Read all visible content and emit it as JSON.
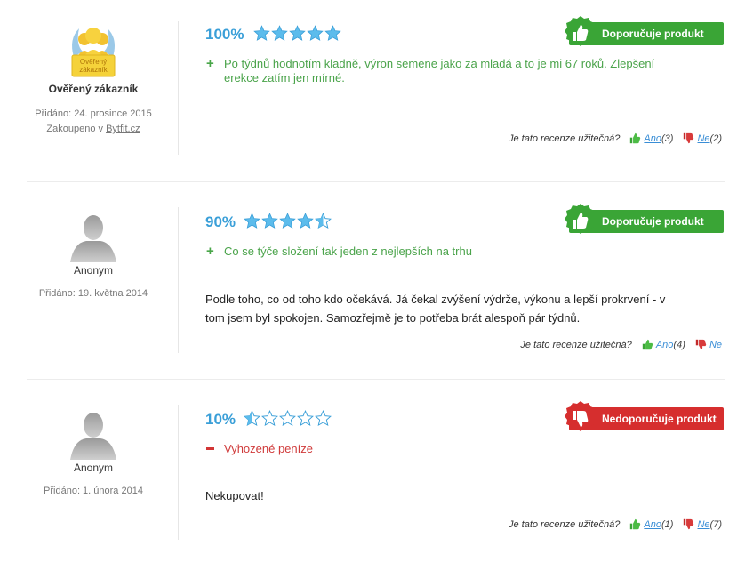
{
  "reviews": [
    {
      "author": "Ověřený zákazník",
      "avatar_badge_text": "Ověřený zákazník",
      "added": "Přidáno: 24. prosince 2015",
      "purchased_prefix": "Zakoupeno v",
      "purchased_shop": "Bytfit.cz",
      "rating_pct": "100%",
      "rating_stars": 5,
      "recommendation": "Doporučuje produkt",
      "recommend": true,
      "pro": "Po týdnů hodnotím kladně, výron semene jako za mladá a to je mi 67 roků. Zlepšení erekce zatím jen mírné.",
      "body": "",
      "helpful_q": "Je tato recenze užitečná?",
      "yes_label": "Ano",
      "yes_count": "(3)",
      "no_label": "Ne",
      "no_count": "(2)"
    },
    {
      "author": "Anonym",
      "added": "Přidáno: 19. května 2014",
      "rating_pct": "90%",
      "rating_stars": 4.5,
      "recommendation": "Doporučuje produkt",
      "recommend": true,
      "pro": "Co se týče složení tak jeden z nejlepších na trhu",
      "body": "Podle toho, co od toho kdo očekává. Já čekal zvýšení výdrže, výkonu a lepší prokrvení - v tom jsem byl spokojen. Samozřejmě je to potřeba brát alespoň pár týdnů.",
      "helpful_q": "Je tato recenze užitečná?",
      "yes_label": "Ano",
      "yes_count": "(4)",
      "no_label": "Ne",
      "no_count": ""
    },
    {
      "author": "Anonym",
      "added": "Přidáno: 1. února 2014",
      "rating_pct": "10%",
      "rating_stars": 0.5,
      "recommendation": "Nedoporučuje produkt",
      "recommend": false,
      "con": "Vyhozené peníze",
      "body": "Nekupovat!",
      "helpful_q": "Je tato recenze užitečná?",
      "yes_label": "Ano",
      "yes_count": "(1)",
      "no_label": "Ne",
      "no_count": "(7)"
    }
  ],
  "colors": {
    "star_blue": "#4fb3e8",
    "good_green": "#3aa536",
    "bad_red": "#d62e2e",
    "link_blue": "#3a8ed6"
  }
}
